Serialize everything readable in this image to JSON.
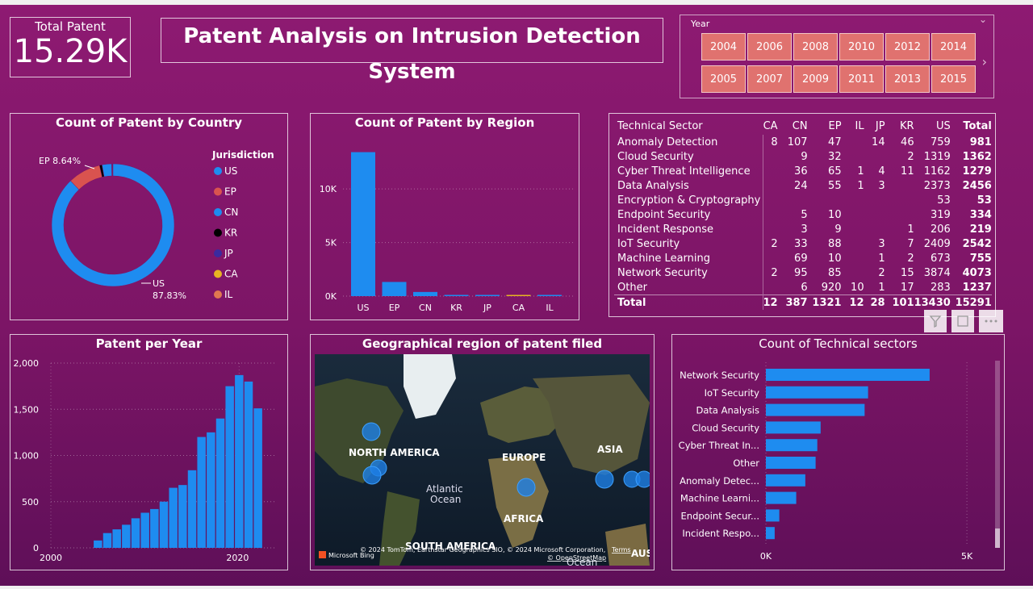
{
  "kpi": {
    "label": "Total Patent",
    "value": "15.29K"
  },
  "title": "Patent Analysis on Intrusion Detection System",
  "year_slicer": {
    "label": "Year",
    "years": [
      "2004",
      "2006",
      "2008",
      "2010",
      "2012",
      "2014",
      "2005",
      "2007",
      "2009",
      "2011",
      "2013",
      "2015"
    ]
  },
  "country_chart": {
    "title": "Count of Patent by Country",
    "legend_title": "Jurisdiction",
    "legend": [
      {
        "name": "US",
        "color": "#1e8cf0"
      },
      {
        "name": "EP",
        "color": "#d9534f"
      },
      {
        "name": "CN",
        "color": "#1e8cf0"
      },
      {
        "name": "KR",
        "color": "#000000"
      },
      {
        "name": "JP",
        "color": "#3b2a9e"
      },
      {
        "name": "CA",
        "color": "#e6b422"
      },
      {
        "name": "IL",
        "color": "#e07850"
      }
    ],
    "ep_label": "EP 8.64%",
    "us_label_1": "US",
    "us_label_2": "87.83%"
  },
  "region_chart": {
    "title": "Count of Patent by Region",
    "yticks": [
      "10K",
      "5K",
      "0K"
    ]
  },
  "matrix": {
    "headers": [
      "Technical Sector",
      "CA",
      "CN",
      "EP",
      "IL",
      "JP",
      "KR",
      "US",
      "Total"
    ],
    "rows": [
      [
        "Anomaly Detection",
        "8",
        "107",
        "47",
        "",
        "14",
        "46",
        "759",
        "981"
      ],
      [
        "Cloud Security",
        "",
        "9",
        "32",
        "",
        "",
        "2",
        "1319",
        "1362"
      ],
      [
        "Cyber Threat Intelligence",
        "",
        "36",
        "65",
        "1",
        "4",
        "11",
        "1162",
        "1279"
      ],
      [
        "Data Analysis",
        "",
        "24",
        "55",
        "1",
        "3",
        "",
        "2373",
        "2456"
      ],
      [
        "Encryption & Cryptography",
        "",
        "",
        "",
        "",
        "",
        "",
        "53",
        "53"
      ],
      [
        "Endpoint Security",
        "",
        "5",
        "10",
        "",
        "",
        "",
        "319",
        "334"
      ],
      [
        "Incident Response",
        "",
        "3",
        "9",
        "",
        "",
        "1",
        "206",
        "219"
      ],
      [
        "IoT Security",
        "2",
        "33",
        "88",
        "",
        "3",
        "7",
        "2409",
        "2542"
      ],
      [
        "Machine Learning",
        "",
        "69",
        "10",
        "",
        "1",
        "2",
        "673",
        "755"
      ],
      [
        "Network Security",
        "2",
        "95",
        "85",
        "",
        "2",
        "15",
        "3874",
        "4073"
      ],
      [
        "Other",
        "",
        "6",
        "920",
        "10",
        "1",
        "17",
        "283",
        "1237"
      ]
    ],
    "total": [
      "Total",
      "12",
      "387",
      "1321",
      "12",
      "28",
      "101",
      "13430",
      "15291"
    ]
  },
  "year_chart": {
    "title": "Patent per Year",
    "yticks": [
      "2,000",
      "1,500",
      "1,000",
      "500",
      "0"
    ],
    "xticks": [
      "2000",
      "2020"
    ]
  },
  "map": {
    "title": "Geographical region of patent filed",
    "labels": [
      "NORTH AMERICA",
      "EUROPE",
      "ASIA",
      "AFRICA",
      "SOUTH AMERICA",
      "AUS",
      "Atlantic",
      "Ocean",
      "Ocean"
    ],
    "attribution": "© 2024 TomTom, Earthstar Geographics SIO, © 2024 Microsoft Corporation,",
    "terms": "Terms",
    "osm": "© OpenStreetMap",
    "bing": "Microsoft Bing"
  },
  "sector_chart": {
    "title": "Count of Technical sectors",
    "xticks": [
      "0K",
      "5K"
    ]
  },
  "chart_data": [
    {
      "type": "pie",
      "title": "Count of Patent by Country",
      "categories": [
        "US",
        "EP",
        "CN",
        "KR",
        "JP",
        "CA",
        "IL"
      ],
      "values": [
        13430,
        1321,
        387,
        101,
        28,
        12,
        12
      ],
      "legend_title": "Jurisdiction"
    },
    {
      "type": "bar",
      "title": "Count of Patent by Region",
      "categories": [
        "US",
        "EP",
        "CN",
        "KR",
        "JP",
        "CA",
        "IL"
      ],
      "values": [
        13430,
        1321,
        387,
        101,
        28,
        12,
        12
      ],
      "ylim": [
        0,
        14000
      ]
    },
    {
      "type": "bar",
      "title": "Patent per Year",
      "x": [
        2005,
        2006,
        2007,
        2008,
        2009,
        2010,
        2011,
        2012,
        2013,
        2014,
        2015,
        2016,
        2017,
        2018,
        2019,
        2020,
        2021,
        2022
      ],
      "values": [
        80,
        160,
        200,
        250,
        320,
        380,
        420,
        500,
        650,
        680,
        840,
        1200,
        1250,
        1400,
        1750,
        1870,
        1800,
        1510
      ],
      "ylim": [
        0,
        2000
      ],
      "xlim": [
        2000,
        2024
      ]
    },
    {
      "type": "bar",
      "title": "Count of Technical sectors",
      "orientation": "horizontal",
      "categories": [
        "Network Security",
        "IoT Security",
        "Data Analysis",
        "Cloud Security",
        "Cyber Threat In...",
        "Other",
        "Anomaly Detec...",
        "Machine Learni...",
        "Endpoint Secur...",
        "Incident Respo..."
      ],
      "values": [
        4073,
        2542,
        2456,
        1362,
        1279,
        1237,
        981,
        755,
        334,
        219
      ],
      "xlim": [
        0,
        5500
      ]
    }
  ]
}
